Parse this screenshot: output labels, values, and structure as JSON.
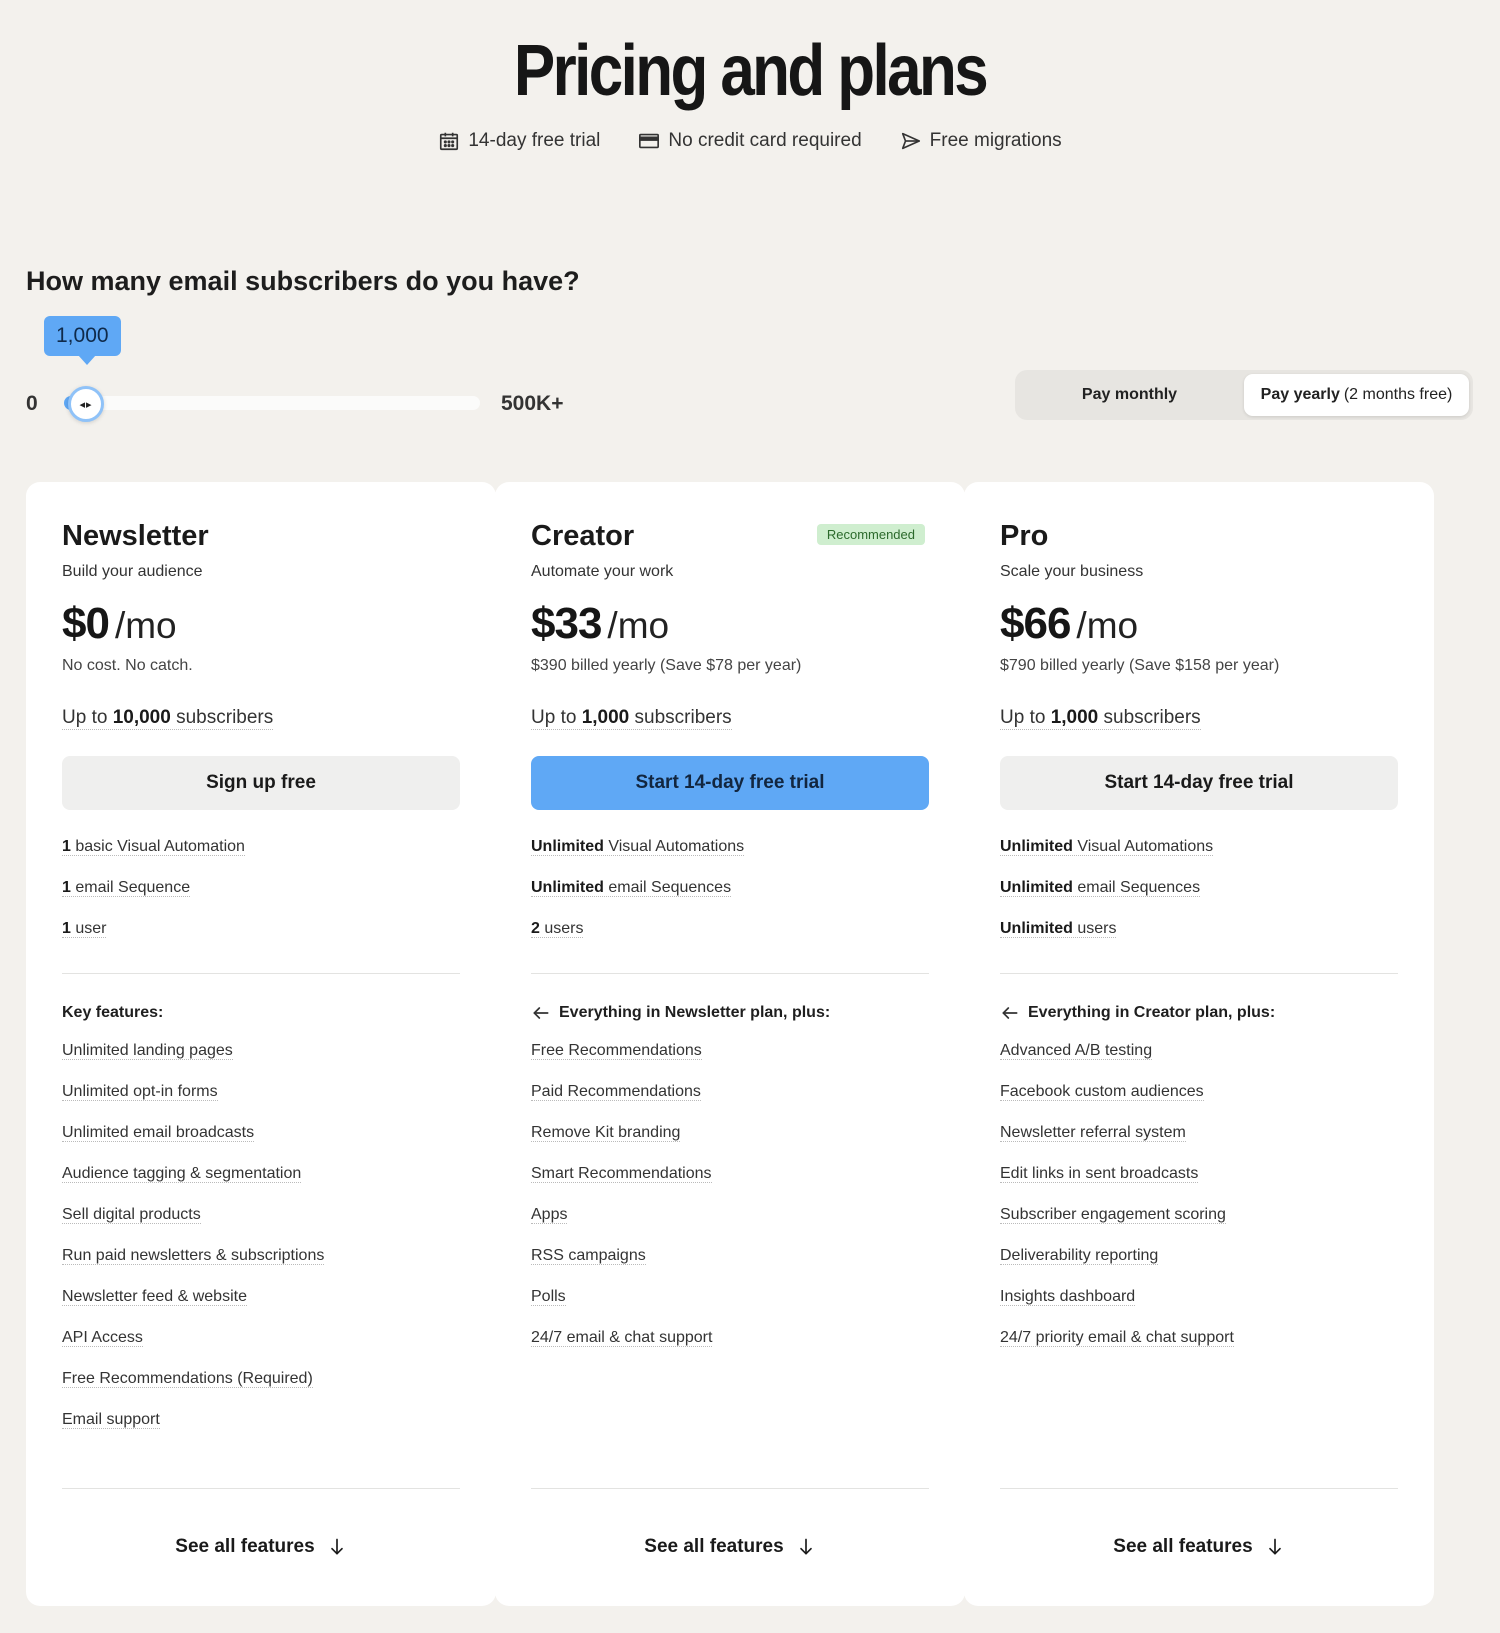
{
  "header": {
    "title": "Pricing and plans",
    "perks": [
      {
        "icon": "calendar-icon",
        "label": "14-day free trial"
      },
      {
        "icon": "credit-card-icon",
        "label": "No credit card required"
      },
      {
        "icon": "send-icon",
        "label": "Free migrations"
      }
    ]
  },
  "subscribers": {
    "question": "How many email subscribers do you have?",
    "value_label": "1,000",
    "min_label": "0",
    "max_label": "500K+",
    "level_fraction": 0.05
  },
  "billing": {
    "monthly_label": "Pay monthly",
    "yearly_label": "Pay yearly",
    "yearly_note": "(2 months free)",
    "selected": "yearly"
  },
  "plans": [
    {
      "name": "Newsletter",
      "tagline": "Build your audience",
      "price": "$0",
      "per": "/mo",
      "billed": "No cost. No catch.",
      "limit_prefix": "Up to ",
      "limit_value": "10,000",
      "limit_suffix": " subscribers",
      "cta": "Sign up free",
      "limits": [
        {
          "strong": "1",
          "text": " basic Visual Automation"
        },
        {
          "strong": "1",
          "text": " email Sequence"
        },
        {
          "strong": "1",
          "text": " user"
        }
      ],
      "features_heading": "Key features:",
      "features": [
        "Unlimited landing pages",
        "Unlimited opt-in forms",
        "Unlimited email broadcasts",
        "Audience tagging & segmentation",
        "Sell digital products",
        "Run paid newsletters & subscriptions",
        "Newsletter feed & website",
        "API Access",
        "Free Recommendations (Required)",
        "Email support"
      ],
      "see_all": "See all features"
    },
    {
      "name": "Creator",
      "badge": "Recommended",
      "tagline": "Automate your work",
      "price": "$33",
      "per": "/mo",
      "billed": "$390 billed yearly (Save $78 per year)",
      "limit_prefix": "Up to ",
      "limit_value": "1,000",
      "limit_suffix": " subscribers",
      "cta": "Start 14-day free trial",
      "limits": [
        {
          "strong": "Unlimited",
          "text": " Visual Automations"
        },
        {
          "strong": "Unlimited",
          "text": " email Sequences"
        },
        {
          "strong": "2",
          "text": " users"
        }
      ],
      "features_heading": "Everything in Newsletter plan, plus:",
      "features": [
        "Free Recommendations",
        "Paid Recommendations",
        "Remove Kit branding",
        "Smart Recommendations",
        "Apps",
        "RSS campaigns",
        "Polls",
        "24/7 email & chat support"
      ],
      "see_all": "See all features"
    },
    {
      "name": "Pro",
      "tagline": "Scale your business",
      "price": "$66",
      "per": "/mo",
      "billed": "$790 billed yearly (Save $158 per year)",
      "limit_prefix": "Up to ",
      "limit_value": "1,000",
      "limit_suffix": " subscribers",
      "cta": "Start 14-day free trial",
      "limits": [
        {
          "strong": "Unlimited",
          "text": " Visual Automations"
        },
        {
          "strong": "Unlimited",
          "text": " email Sequences"
        },
        {
          "strong": "Unlimited",
          "text": " users"
        }
      ],
      "features_heading": "Everything in Creator plan, plus:",
      "features": [
        "Advanced A/B testing",
        "Facebook custom audiences",
        "Newsletter referral system",
        "Edit links in sent broadcasts",
        "Subscriber engagement scoring",
        "Deliverability reporting",
        "Insights dashboard",
        "24/7 priority email & chat support"
      ],
      "see_all": "See all features"
    }
  ],
  "colors": {
    "accent": "#5fa8f5",
    "background": "#f3f1ed",
    "badge_bg": "#cfeecf"
  }
}
